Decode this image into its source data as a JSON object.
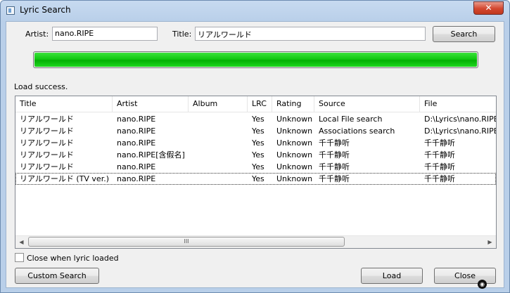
{
  "window": {
    "title": "Lyric Search",
    "close_glyph": "✕"
  },
  "search": {
    "artist_label": "Artist:",
    "artist_value": "nano.RIPE",
    "title_label": "Title:",
    "title_value": "リアルワールド",
    "search_label": "Search"
  },
  "progress": {
    "percent": 100
  },
  "status": "Load success.",
  "table": {
    "columns": [
      "Title",
      "Artist",
      "Album",
      "LRC",
      "Rating",
      "Source",
      "File"
    ],
    "rows": [
      [
        "リアルワールド",
        "nano.RIPE",
        "",
        "Yes",
        "Unknown",
        "Local File search",
        "D:\\Lyrics\\nano.RIPE -"
      ],
      [
        "リアルワールド",
        "nano.RIPE",
        "",
        "Yes",
        "Unknown",
        "Associations search",
        "D:\\Lyrics\\nano.RIPE -"
      ],
      [
        "リアルワールド",
        "nano.RIPE",
        "",
        "Yes",
        "Unknown",
        "千千静听",
        "千千静听"
      ],
      [
        "リアルワールド",
        "nano.RIPE[含假名]",
        "",
        "Yes",
        "Unknown",
        "千千静听",
        "千千静听"
      ],
      [
        "リアルワールド",
        "nano.RIPE",
        "",
        "Yes",
        "Unknown",
        "千千静听",
        "千千静听"
      ],
      [
        "リアルワールド (TV ver.)",
        "nano.RIPE",
        "",
        "Yes",
        "Unknown",
        "千千静听",
        "千千静听"
      ]
    ],
    "selected_row": 5,
    "scroll_left": "◀",
    "scroll_right": "▶",
    "scroll_grip": "III"
  },
  "options": {
    "close_when_loaded_label": "Close when lyric loaded",
    "close_when_loaded_checked": false
  },
  "buttons": {
    "custom_search": "Custom Search",
    "load": "Load",
    "close": "Close"
  },
  "icons": {
    "app": "window-app-icon",
    "close": "close-icon",
    "resize": "resize-grip-icon"
  },
  "colors": {
    "progress_fill": "#11c811",
    "close_button": "#c7432b"
  }
}
